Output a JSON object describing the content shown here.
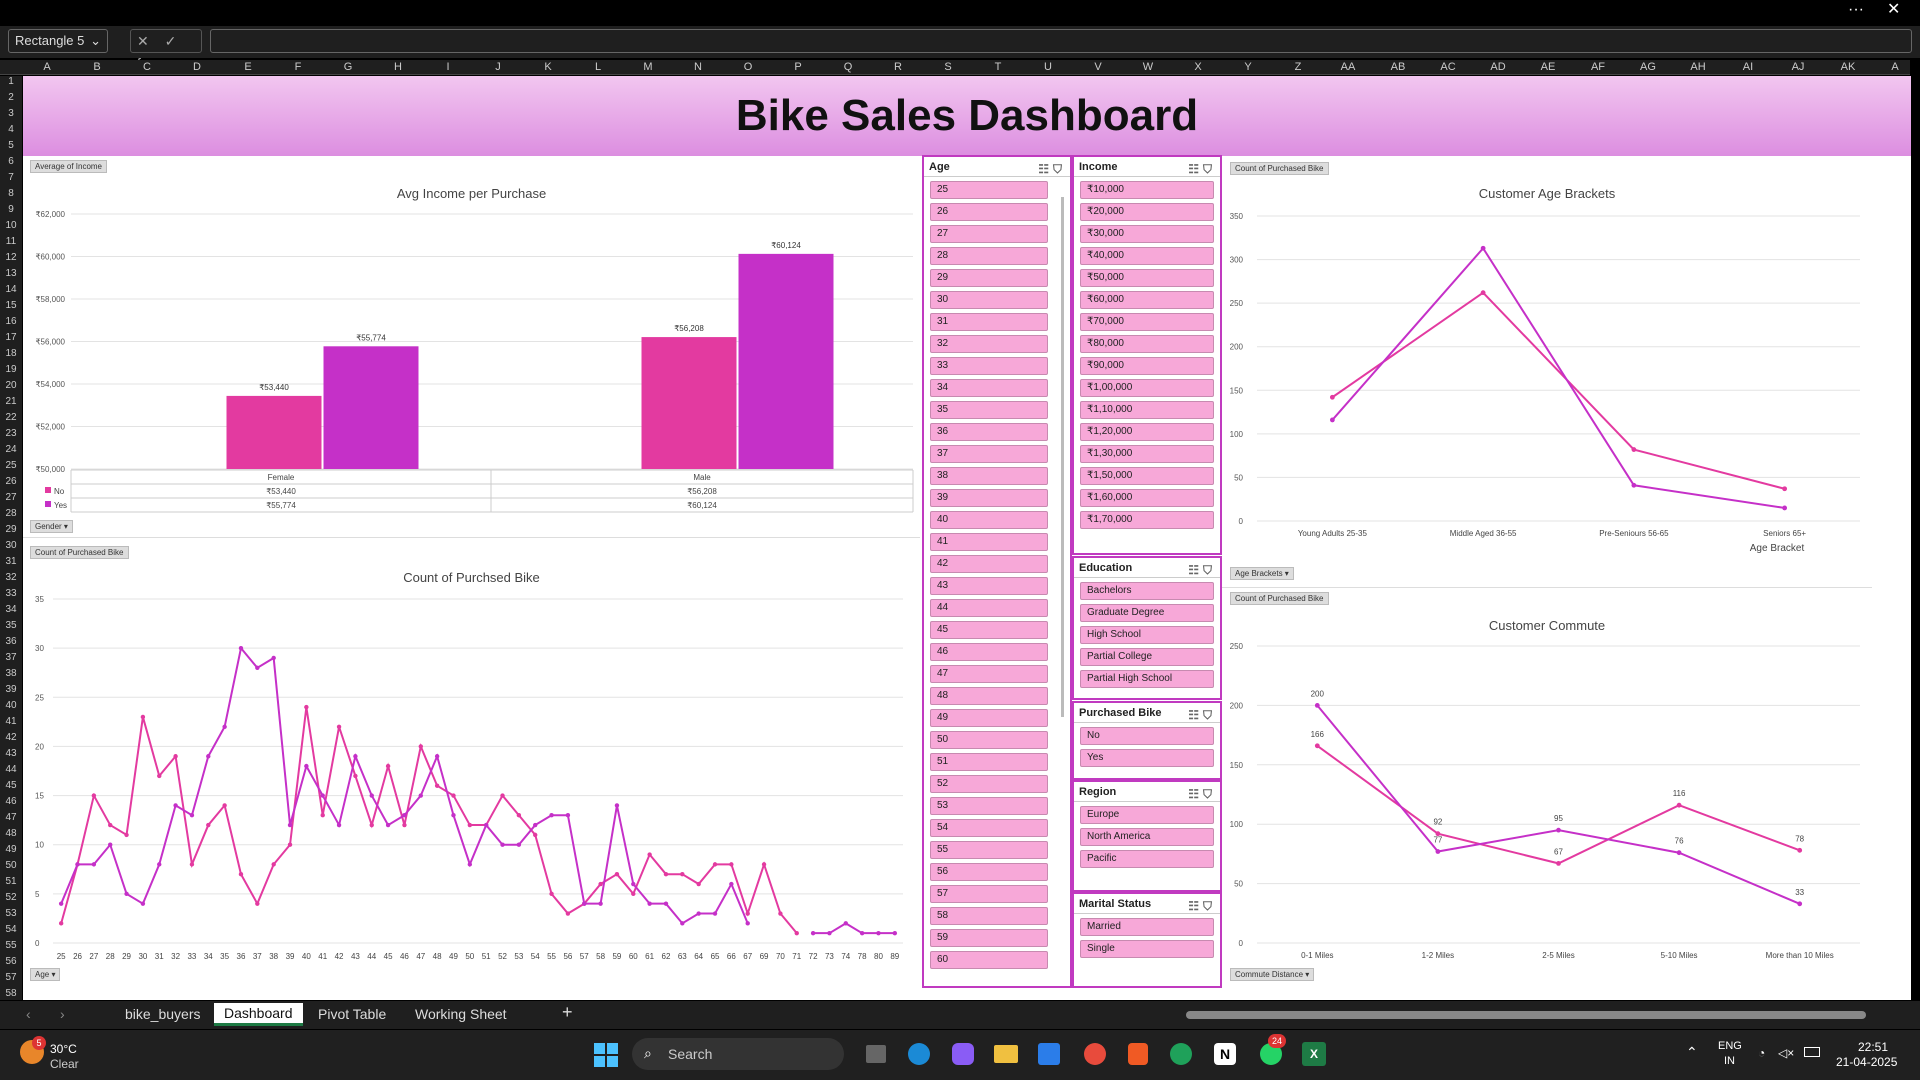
{
  "window": {
    "more": "···",
    "close": "✕"
  },
  "formula_bar": {
    "name_box": "Rectangle 5",
    "fx": "✕ ✓ fx",
    "value": ""
  },
  "columns": [
    "A",
    "B",
    "C",
    "D",
    "E",
    "F",
    "G",
    "H",
    "I",
    "J",
    "K",
    "L",
    "M",
    "N",
    "O",
    "P",
    "Q",
    "R",
    "S",
    "T",
    "U",
    "V",
    "W",
    "X",
    "Y",
    "Z",
    "AA",
    "AB",
    "AC",
    "AD",
    "AE",
    "AF",
    "AG",
    "AH",
    "AI",
    "AJ",
    "AK",
    "A"
  ],
  "rows": [
    "1",
    "2",
    "3",
    "4",
    "5",
    "6",
    "7",
    "8",
    "9",
    "10",
    "11",
    "12",
    "13",
    "14",
    "15",
    "16",
    "17",
    "18",
    "19",
    "20",
    "21",
    "22",
    "23",
    "24",
    "25",
    "26",
    "27",
    "28",
    "29",
    "30",
    "31",
    "32",
    "33",
    "34",
    "35",
    "36",
    "37",
    "38",
    "39",
    "40",
    "41",
    "42",
    "43",
    "44",
    "45",
    "46",
    "47",
    "48",
    "49",
    "50",
    "51",
    "52",
    "53",
    "54",
    "55",
    "56",
    "57",
    "58"
  ],
  "dashboard_title": "Bike Sales Dashboard",
  "charts": {
    "income": {
      "field_btn": "Average of Income",
      "title": "Avg Income per Purchase",
      "filter_btn": "Gender",
      "table": {
        "headers": [
          "Female",
          "Male"
        ],
        "rows": [
          {
            "label": "No",
            "values": [
              "₹53,440",
              "₹56,208"
            ]
          },
          {
            "label": "Yes",
            "values": [
              "₹55,774",
              "₹60,124"
            ]
          }
        ]
      }
    },
    "count": {
      "field_btn": "Count of Purchased Bike",
      "title": "Count of Purchsed Bike",
      "filter_btn": "Age"
    },
    "agebr": {
      "field_btn": "Count of Purchased Bike",
      "title": "Customer Age Brackets",
      "xlabel": "Age Bracket",
      "filter_btn": "Age Brackets"
    },
    "commute": {
      "field_btn": "Count of Purchased Bike",
      "title": "Customer Commute",
      "filter_btn": "Commute Distance"
    }
  },
  "chart_data": [
    {
      "type": "bar",
      "title": "Avg Income per Purchase",
      "categories": [
        "Female",
        "Male"
      ],
      "series": [
        {
          "name": "No",
          "values": [
            53440,
            56208
          ],
          "color": "#e33aa0"
        },
        {
          "name": "Yes",
          "values": [
            55774,
            60124
          ],
          "color": "#c530c8"
        }
      ],
      "ylim": [
        50000,
        62000
      ],
      "yticks": [
        "₹50,000",
        "₹52,000",
        "₹54,000",
        "₹56,000",
        "₹58,000",
        "₹60,000",
        "₹62,000"
      ],
      "labels": [
        [
          "₹53,440",
          "₹56,208"
        ],
        [
          "₹55,774",
          "₹60,124"
        ]
      ]
    },
    {
      "type": "line",
      "title": "Count of Purchsed Bike",
      "x": [
        25,
        26,
        27,
        28,
        29,
        30,
        31,
        32,
        33,
        34,
        35,
        36,
        37,
        38,
        39,
        40,
        41,
        42,
        43,
        44,
        45,
        46,
        47,
        48,
        49,
        50,
        51,
        52,
        53,
        54,
        55,
        56,
        57,
        58,
        59,
        60,
        61,
        62,
        63,
        64,
        65,
        66,
        67,
        68,
        69,
        70,
        71,
        72,
        73,
        74,
        75,
        76,
        77,
        78,
        79,
        80,
        81,
        82,
        83,
        84,
        85,
        86,
        87,
        88,
        89
      ],
      "xticks": [
        "25",
        "26",
        "27",
        "28",
        "29",
        "30",
        "31",
        "32",
        "33",
        "34",
        "35",
        "36",
        "37",
        "38",
        "39",
        "40",
        "41",
        "42",
        "43",
        "44",
        "45",
        "46",
        "47",
        "48",
        "49",
        "50",
        "51",
        "52",
        "53",
        "54",
        "55",
        "56",
        "57",
        "58",
        "59",
        "60",
        "61",
        "62",
        "63",
        "64",
        "65",
        "66",
        "67",
        "69",
        "70",
        "71",
        "72",
        "73",
        "74",
        "78",
        "80",
        "89"
      ],
      "ylim": [
        0,
        35
      ],
      "yticks": [
        "0",
        "5",
        "10",
        "15",
        "20",
        "25",
        "30",
        "35"
      ],
      "series": [
        {
          "name": "No",
          "color": "#e33aa0",
          "values": [
            2,
            8,
            15,
            12,
            11,
            23,
            17,
            19,
            8,
            12,
            14,
            7,
            4,
            8,
            10,
            24,
            13,
            22,
            17,
            12,
            18,
            12,
            20,
            16,
            15,
            12,
            12,
            15,
            13,
            11,
            5,
            3,
            4,
            6,
            7,
            5,
            9,
            7,
            7,
            6,
            8,
            8,
            3,
            8,
            3,
            1,
            null,
            null,
            null,
            null,
            null,
            null,
            null,
            null,
            null,
            null,
            null,
            null,
            null,
            null,
            null,
            null,
            null,
            null,
            null
          ]
        },
        {
          "name": "Yes",
          "color": "#c530c8",
          "values": [
            4,
            8,
            8,
            10,
            5,
            4,
            8,
            14,
            13,
            19,
            22,
            30,
            28,
            29,
            12,
            18,
            15,
            12,
            19,
            15,
            12,
            13,
            15,
            19,
            13,
            8,
            12,
            10,
            10,
            12,
            13,
            13,
            4,
            4,
            14,
            6,
            4,
            4,
            2,
            3,
            3,
            6,
            2,
            null,
            null,
            null,
            1,
            1,
            2,
            1,
            1,
            1,
            1,
            null,
            null,
            null,
            null,
            null,
            null,
            null,
            null,
            null,
            null,
            null,
            null
          ]
        }
      ]
    },
    {
      "type": "line",
      "title": "Customer Age Brackets",
      "categories": [
        "Young Adults 25-35",
        "Middle Aged 36-55",
        "Pre-Seniours 56-65",
        "Seniors 65+"
      ],
      "xlabel": "Age Bracket",
      "ylim": [
        0,
        350
      ],
      "yticks": [
        "0",
        "50",
        "100",
        "150",
        "200",
        "250",
        "300",
        "350"
      ],
      "series": [
        {
          "name": "No",
          "color": "#e33aa0",
          "values": [
            142,
            262,
            82,
            37
          ]
        },
        {
          "name": "Yes",
          "color": "#c530c8",
          "values": [
            116,
            313,
            41,
            15
          ]
        }
      ]
    },
    {
      "type": "line",
      "title": "Customer Commute",
      "categories": [
        "0-1 Miles",
        "1-2 Miles",
        "2-5 Miles",
        "5-10 Miles",
        "More than 10 Miles"
      ],
      "ylim": [
        0,
        250
      ],
      "yticks": [
        "0",
        "50",
        "100",
        "150",
        "200",
        "250"
      ],
      "series": [
        {
          "name": "No",
          "color": "#e33aa0",
          "values": [
            166,
            92,
            67,
            116,
            78
          ]
        },
        {
          "name": "Yes",
          "color": "#c530c8",
          "values": [
            200,
            77,
            95,
            76,
            33
          ]
        }
      ]
    }
  ],
  "slicers": {
    "age": {
      "title": "Age",
      "items": [
        "25",
        "26",
        "27",
        "28",
        "29",
        "30",
        "31",
        "32",
        "33",
        "34",
        "35",
        "36",
        "37",
        "38",
        "39",
        "40",
        "41",
        "42",
        "43",
        "44",
        "45",
        "46",
        "47",
        "48",
        "49",
        "50",
        "51",
        "52",
        "53",
        "54",
        "55",
        "56",
        "57",
        "58",
        "59",
        "60"
      ]
    },
    "income": {
      "title": "Income",
      "items": [
        "₹10,000",
        "₹20,000",
        "₹30,000",
        "₹40,000",
        "₹50,000",
        "₹60,000",
        "₹70,000",
        "₹80,000",
        "₹90,000",
        "₹1,00,000",
        "₹1,10,000",
        "₹1,20,000",
        "₹1,30,000",
        "₹1,50,000",
        "₹1,60,000",
        "₹1,70,000"
      ]
    },
    "education": {
      "title": "Education",
      "items": [
        "Bachelors",
        "Graduate Degree",
        "High School",
        "Partial College",
        "Partial High School"
      ]
    },
    "purchased": {
      "title": "Purchased Bike",
      "items": [
        "No",
        "Yes"
      ]
    },
    "region": {
      "title": "Region",
      "items": [
        "Europe",
        "North America",
        "Pacific"
      ]
    },
    "marital": {
      "title": "Marital Status",
      "items": [
        "Married",
        "Single"
      ]
    }
  },
  "tabs": [
    "bike_buyers",
    "Dashboard",
    "Pivot Table",
    "Working Sheet"
  ],
  "taskbar": {
    "temp": "30°C",
    "weather": "Clear",
    "search": "Search",
    "lang1": "ENG",
    "lang2": "IN",
    "time": "22:51",
    "date": "21-04-2025",
    "badge_weather": "5",
    "badge_whatsapp": "24"
  }
}
